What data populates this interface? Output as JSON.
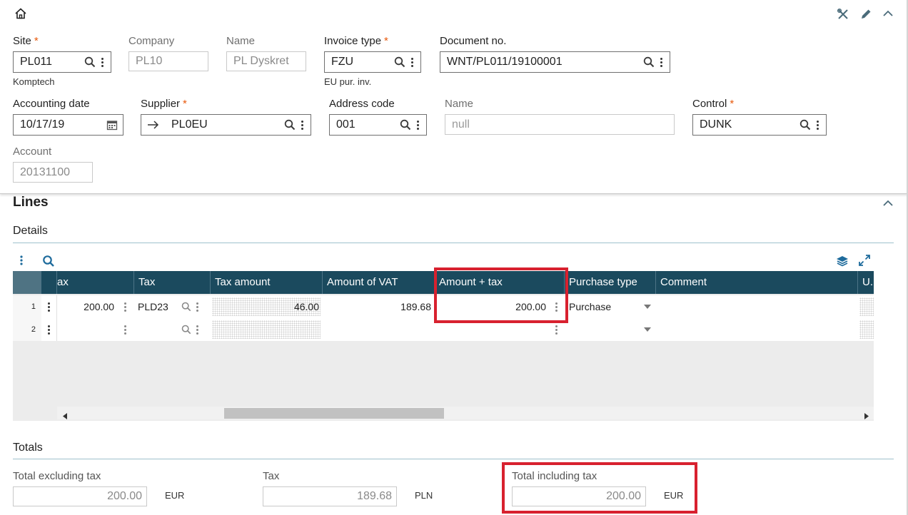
{
  "header": {
    "site": {
      "label": "Site",
      "value": "PL011",
      "sub": "Komptech"
    },
    "company": {
      "label": "Company",
      "value": "PL10"
    },
    "name1": {
      "label": "Name",
      "value": "PL Dyskret"
    },
    "invoice_type": {
      "label": "Invoice type",
      "value": "FZU",
      "sub": "EU pur. inv."
    },
    "document_no": {
      "label": "Document no.",
      "value": "WNT/PL011/19100001"
    },
    "accounting_date": {
      "label": "Accounting date",
      "value": "10/17/19"
    },
    "supplier": {
      "label": "Supplier",
      "value": "PL0EU"
    },
    "address_code": {
      "label": "Address code",
      "value": "001"
    },
    "name2": {
      "label": "Name",
      "placeholder": "null"
    },
    "control": {
      "label": "Control",
      "value": "DUNK"
    },
    "account": {
      "label": "Account",
      "value": "20131100"
    },
    "required_marker": "*"
  },
  "lines": {
    "title": "Lines",
    "details_title": "Details",
    "columns": [
      "ax",
      "Tax",
      "Tax amount",
      "Amount of VAT",
      "Amount + tax",
      "Purchase type",
      "Comment",
      "U..."
    ],
    "rows": [
      {
        "num": "1",
        "amount": "200.00",
        "tax": "PLD23",
        "tax_amount": "46.00",
        "vat": "189.68",
        "amount_tax": "200.00",
        "purchase_type": "Purchase"
      },
      {
        "num": "2",
        "amount": "",
        "tax": "",
        "tax_amount": "",
        "vat": "",
        "amount_tax": "",
        "purchase_type": ""
      }
    ]
  },
  "totals": {
    "title": "Totals",
    "excl": {
      "label": "Total excluding tax",
      "value": "200.00",
      "currency": "EUR"
    },
    "tax": {
      "label": "Tax",
      "value": "189.68",
      "currency": "PLN"
    },
    "incl": {
      "label": "Total including tax",
      "value": "200.00",
      "currency": "EUR"
    }
  },
  "colors": {
    "grid_header": "#1b4a5e",
    "highlight": "#d8212f",
    "required": "#e8590c"
  }
}
